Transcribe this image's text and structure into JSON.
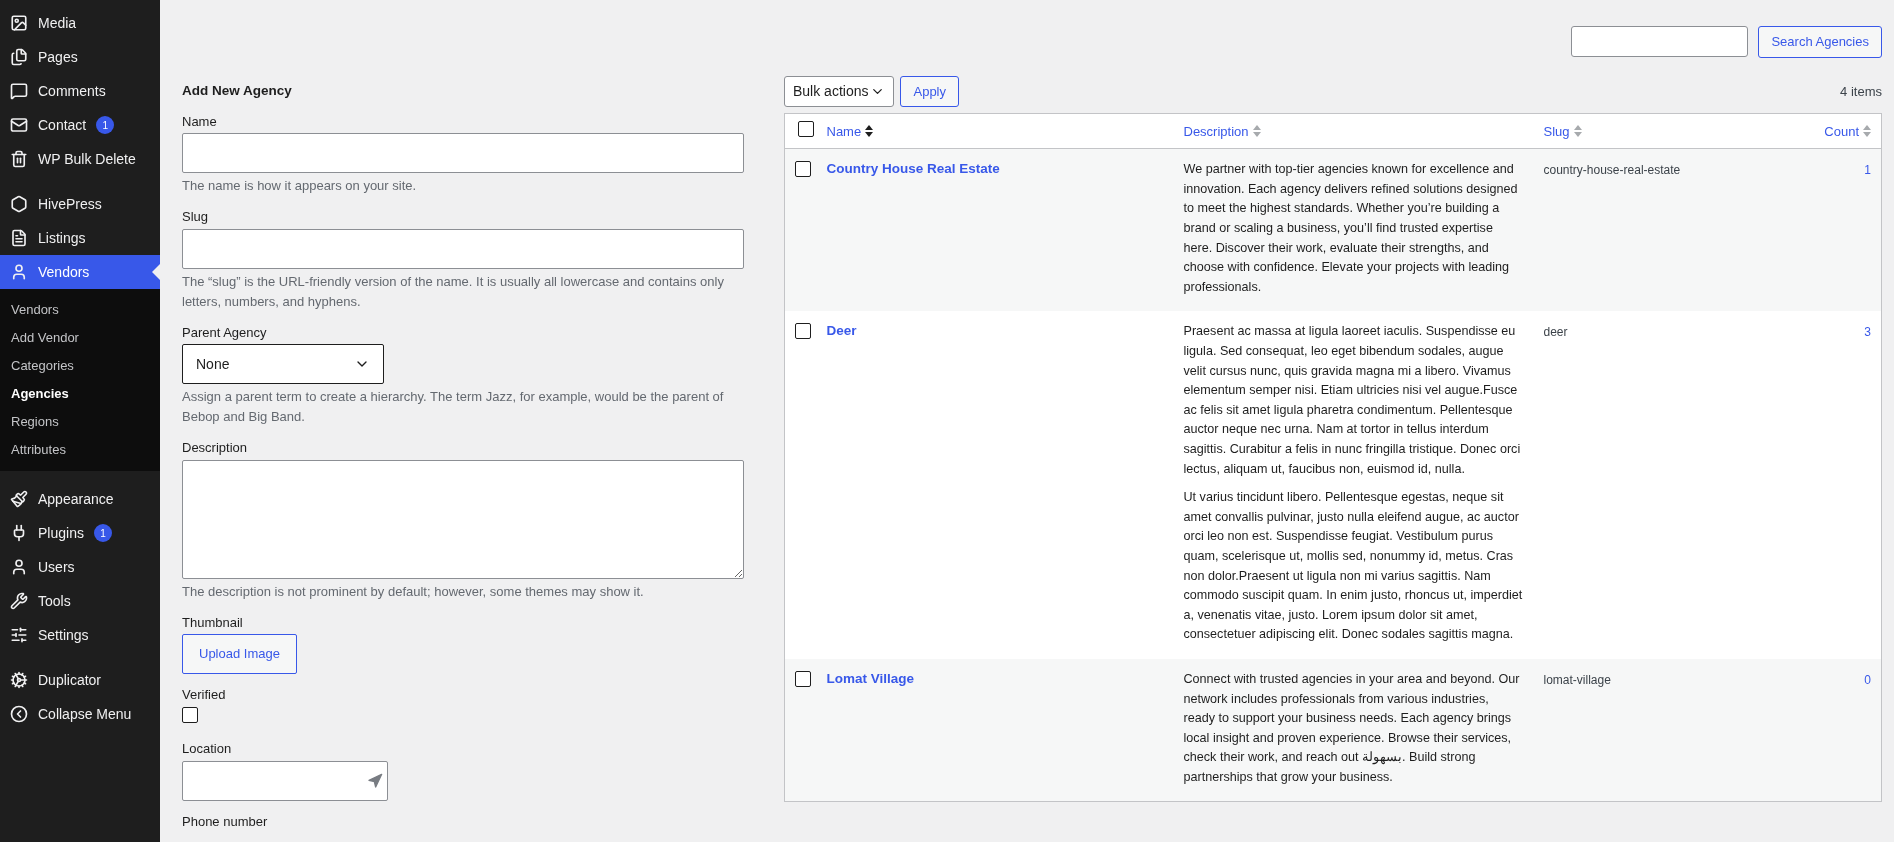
{
  "sidebar": {
    "groups": [
      [
        {
          "label": "Media",
          "selected": false
        },
        {
          "label": "Pages",
          "selected": false
        },
        {
          "label": "Comments",
          "selected": false
        },
        {
          "label": "Contact",
          "badge": "1",
          "selected": false
        },
        {
          "label": "WP Bulk Delete",
          "selected": false
        }
      ],
      [
        {
          "label": "HivePress",
          "selected": false
        },
        {
          "label": "Listings",
          "selected": false
        },
        {
          "label": "Vendors",
          "selected": true,
          "children": [
            {
              "label": "Vendors",
              "selected": false
            },
            {
              "label": "Add Vendor",
              "selected": false
            },
            {
              "label": "Categories",
              "selected": false
            },
            {
              "label": "Agencies",
              "selected": true
            },
            {
              "label": "Regions",
              "selected": false
            },
            {
              "label": "Attributes",
              "selected": false
            }
          ]
        }
      ],
      [
        {
          "label": "Appearance",
          "selected": false
        },
        {
          "label": "Plugins",
          "badge": "1",
          "selected": false
        },
        {
          "label": "Users",
          "selected": false
        },
        {
          "label": "Tools",
          "selected": false
        },
        {
          "label": "Settings",
          "selected": false
        }
      ],
      [
        {
          "label": "Duplicator",
          "selected": false
        },
        {
          "label": "Collapse Menu",
          "selected": false
        }
      ]
    ]
  },
  "form": {
    "title": "Add New Agency",
    "fields": [
      {
        "kind": "text",
        "label": "Name",
        "help": "The name is how it appears on your site."
      },
      {
        "kind": "text",
        "label": "Slug",
        "help": "The “slug” is the URL-friendly version of the name. It is usually all lowercase and contains only letters, numbers, and hyphens."
      },
      {
        "kind": "select",
        "label": "Parent Agency",
        "value": "None",
        "help": "Assign a parent term to create a hierarchy. The term Jazz, for example, would be the parent of Bebop and Big Band."
      },
      {
        "kind": "textarea",
        "label": "Description",
        "help": "The description is not prominent by default; however, some themes may show it."
      },
      {
        "kind": "upload",
        "label": "Thumbnail",
        "button": "Upload Image"
      },
      {
        "kind": "checkbox",
        "label": "Verified",
        "checked": false
      },
      {
        "kind": "location",
        "label": "Location"
      },
      {
        "kind": "label",
        "label": "Phone number"
      }
    ]
  },
  "search": {
    "button": "Search Agencies"
  },
  "bulk": {
    "select": "Bulk actions",
    "apply": "Apply",
    "count": "4 items"
  },
  "table": {
    "select_all_checked": false,
    "columns": [
      {
        "label": "Name",
        "sorted": true
      },
      {
        "label": "Description",
        "sorted": false
      },
      {
        "label": "Slug",
        "sorted": false
      },
      {
        "label": "Count",
        "sorted": false
      }
    ],
    "rows": [
      {
        "checked": false,
        "name": "Country House Real Estate",
        "description": [
          "We partner with top-tier agencies known for excellence and innovation. Each agency delivers refined solutions designed to meet the highest standards. Whether you’re building a brand or scaling a business, you’ll find trusted expertise here. Discover their work, evaluate their strengths, and choose with confidence. Elevate your projects with leading professionals."
        ],
        "slug": "country-house-real-estate",
        "count": "1"
      },
      {
        "checked": false,
        "name": "Deer",
        "description": [
          "Praesent ac massa at ligula laoreet iaculis. Suspendisse eu ligula. Sed consequat, leo eget bibendum sodales, augue velit cursus nunc, quis gravida magna mi a libero. Vivamus elementum semper nisi. Etiam ultricies nisi vel augue.Fusce ac felis sit amet ligula pharetra condimentum. Pellentesque auctor neque nec urna. Nam at tortor in tellus interdum sagittis. Curabitur a felis in nunc fringilla tristique. Donec orci lectus, aliquam ut, faucibus non, euismod id, nulla.",
          "Ut varius tincidunt libero. Pellentesque egestas, neque sit amet convallis pulvinar, justo nulla eleifend augue, ac auctor orci leo non est. Suspendisse feugiat. Vestibulum purus quam, scelerisque ut, mollis sed, nonummy id, metus. Cras non dolor.Praesent ut ligula non mi varius sagittis. Nam commodo suscipit quam. In enim justo, rhoncus ut, imperdiet a, venenatis vitae, justo. Lorem ipsum dolor sit amet, consectetuer adipiscing elit. Donec sodales sagittis magna."
        ],
        "slug": "deer",
        "count": "3"
      },
      {
        "checked": false,
        "name": "Lomat Village",
        "description": [
          "Connect with trusted agencies in your area and beyond. Our network includes professionals from various industries, ready to support your business needs. Each agency brings local insight and proven experience. Browse their services, check their work, and reach out بسهولة. Build strong partnerships that grow your business."
        ],
        "slug": "lomat-village",
        "count": "0"
      }
    ]
  }
}
